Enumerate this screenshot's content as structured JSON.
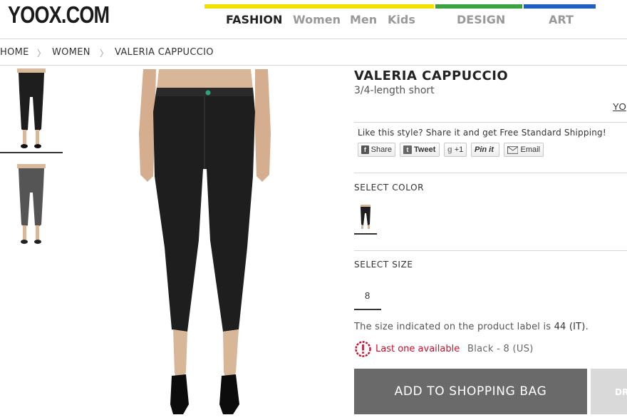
{
  "header": {
    "logo": "YOOX.COM",
    "nav": {
      "fashion": "FASHION",
      "women": "Women",
      "men": "Men",
      "kids": "Kids",
      "design": "DESIGN",
      "art": "ART"
    },
    "colors": {
      "fashion": "#f2e000",
      "design": "#3aa23e",
      "art": "#1e5fbf"
    }
  },
  "breadcrumb": {
    "home": "HOME",
    "women": "WOMEN",
    "brand": "VALERIA CAPPUCCIO",
    "separator": "〉"
  },
  "product": {
    "brand": "VALERIA CAPPUCCIO",
    "subtitle": "3/4-length short",
    "yoox_link": "YO"
  },
  "share": {
    "text": "Like this style? Share it and get Free Standard Shipping!",
    "facebook": "Share",
    "twitter": "Tweet",
    "gplus": "+1",
    "pinterest": "Pin it",
    "email": "Email"
  },
  "color_section": {
    "label": "SELECT COLOR"
  },
  "size_section": {
    "label": "SELECT SIZE",
    "value": "8",
    "note_prefix": "The size indicated on the product label is ",
    "note_size": "44 (IT)",
    "note_suffix": "."
  },
  "availability": {
    "text": "Last one available",
    "variant": "Black - 8 (US)",
    "alert_color": "#c8102e"
  },
  "actions": {
    "add_to_bag": "ADD TO SHOPPING BAG",
    "dream_box": "DR"
  }
}
